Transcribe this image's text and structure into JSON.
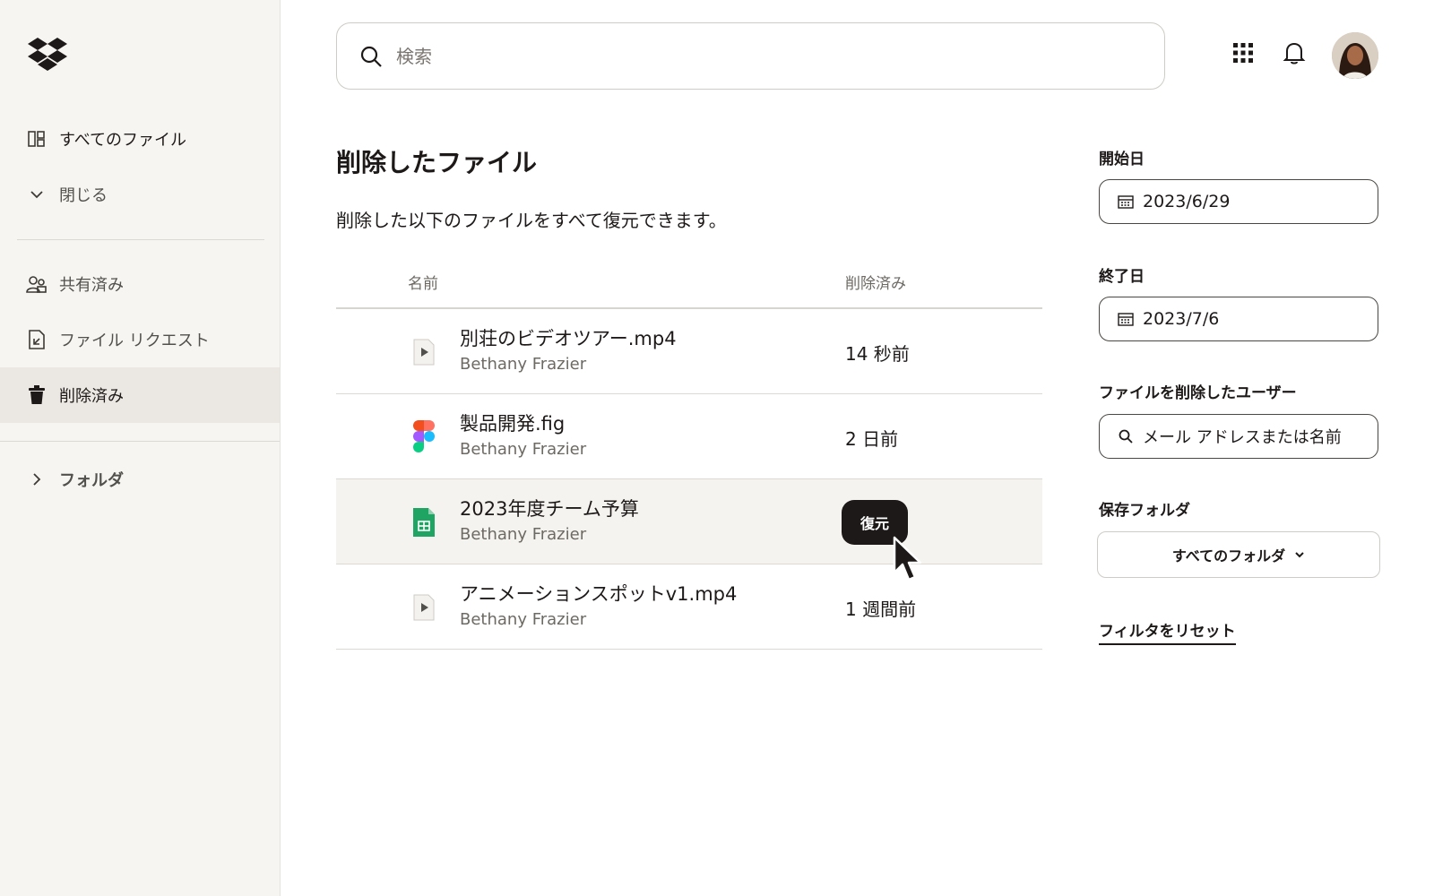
{
  "sidebar": {
    "items": [
      {
        "label": "すべてのファイル",
        "icon": "grid-files-icon"
      },
      {
        "label": "閉じる",
        "icon": "chevron-down-icon"
      },
      {
        "label": "共有済み",
        "icon": "people-icon"
      },
      {
        "label": "ファイル リクエスト",
        "icon": "file-request-icon"
      },
      {
        "label": "削除済み",
        "icon": "trash-icon",
        "active": true
      },
      {
        "label": "フォルダ",
        "icon": "chevron-right-icon"
      }
    ]
  },
  "search": {
    "placeholder": "検索"
  },
  "main": {
    "title": "削除したファイル",
    "subtitle": "削除した以下のファイルをすべて復元できます。",
    "columns": {
      "name": "名前",
      "deleted": "削除済み"
    },
    "rows": [
      {
        "name": "別荘のビデオツアー.mp4",
        "owner": "Bethany Frazier",
        "deleted": "14 秒前",
        "icon": "video-file-icon"
      },
      {
        "name": "製品開発.fig",
        "owner": "Bethany Frazier",
        "deleted": "2 日前",
        "icon": "figma-file-icon"
      },
      {
        "name": "2023年度チーム予算",
        "owner": "Bethany Frazier",
        "deleted": "",
        "icon": "sheets-file-icon",
        "action": "復元"
      },
      {
        "name": "アニメーションスポットv1.mp4",
        "owner": "Bethany Frazier",
        "deleted": "1 週間前",
        "icon": "video-file-icon"
      }
    ]
  },
  "filters": {
    "start_label": "開始日",
    "start_value": "2023/6/29",
    "end_label": "終了日",
    "end_value": "2023/7/6",
    "user_label": "ファイルを削除したユーザー",
    "user_placeholder": "メール アドレスまたは名前",
    "folder_label": "保存フォルダ",
    "folder_value": "すべてのフォルダ",
    "reset": "フィルタをリセット"
  },
  "colors": {
    "accent": "#1e1919",
    "sidebar_bg": "#f7f5f2",
    "active_bg": "#ebe8e3",
    "sheets_green": "#1fa463"
  }
}
